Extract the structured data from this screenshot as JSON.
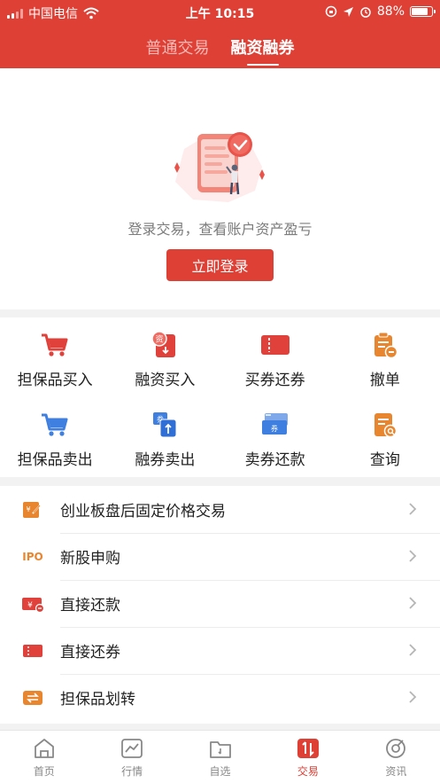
{
  "status": {
    "carrier": "中国电信",
    "time": "上午 10:15",
    "battery": "88%",
    "battery_level": 0.88
  },
  "tabs": [
    {
      "label": "普通交易",
      "active": false
    },
    {
      "label": "融资融券",
      "active": true
    }
  ],
  "login": {
    "hint": "登录交易，查看账户资产盈亏",
    "button": "立即登录"
  },
  "grid": [
    {
      "label": "担保品买入",
      "icon": "cart-icon",
      "color": "#e0413a"
    },
    {
      "label": "融资买入",
      "icon": "finance-buy-icon",
      "color": "#e0413a"
    },
    {
      "label": "买券还券",
      "icon": "ticket-icon",
      "color": "#e0413a"
    },
    {
      "label": "撤单",
      "icon": "cancel-order-icon",
      "color": "#e7862f"
    },
    {
      "label": "担保品卖出",
      "icon": "cart-icon",
      "color": "#3f7fe0"
    },
    {
      "label": "融券卖出",
      "icon": "securities-sell-icon",
      "color": "#3f7fe0"
    },
    {
      "label": "卖券还款",
      "icon": "ticket-stack-icon",
      "color": "#3f7fe0"
    },
    {
      "label": "查询",
      "icon": "query-icon",
      "color": "#e7862f"
    }
  ],
  "list": [
    {
      "label": "创业板盘后固定价格交易",
      "icon": "fixed-price-icon"
    },
    {
      "label": "新股申购",
      "icon": "ipo-icon",
      "icon_text": "IPO"
    },
    {
      "label": "直接还款",
      "icon": "repay-cash-icon"
    },
    {
      "label": "直接还券",
      "icon": "repay-securities-icon"
    },
    {
      "label": "担保品划转",
      "icon": "transfer-icon"
    }
  ],
  "nav": [
    {
      "label": "首页",
      "icon": "home-icon",
      "active": false
    },
    {
      "label": "行情",
      "icon": "chart-icon",
      "active": false
    },
    {
      "label": "自选",
      "icon": "folder-icon",
      "active": false
    },
    {
      "label": "交易",
      "icon": "trade-icon",
      "active": true
    },
    {
      "label": "资讯",
      "icon": "news-icon",
      "active": false
    }
  ],
  "colors": {
    "brand": "#de4036",
    "orange": "#e7862f",
    "blue": "#3f7fe0"
  }
}
